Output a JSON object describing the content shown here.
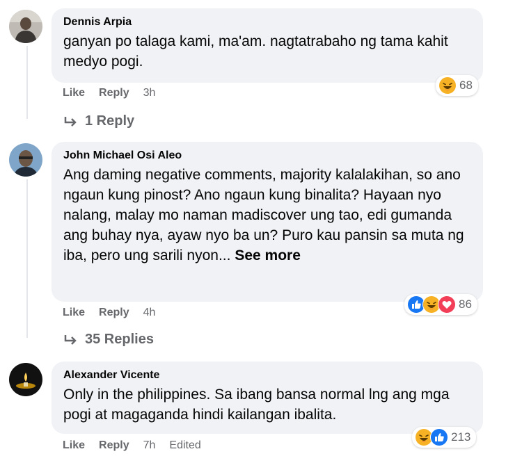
{
  "comments": [
    {
      "author": "Dennis Arpia",
      "text": "ganyan po talaga kami, ma'am. nagtatrabaho ng tama kahit medyo pogi.",
      "like": "Like",
      "reply": "Reply",
      "time": "3h",
      "reaction_count": "68",
      "reactions": [
        "haha-icon"
      ],
      "replies_label": "1 Reply"
    },
    {
      "author": "John Michael Osi Aleo",
      "text": "Ang daming negative comments, majority kalalakihan, so ano ngaun kung pinost? Ano ngaun kung binalita? Hayaan nyo nalang, malay mo naman madiscover ung tao, edi gumanda ang buhay nya, ayaw nyo ba un? Puro kau pansin sa muta ng iba, pero ung sarili nyon...",
      "see_more": "See more",
      "like": "Like",
      "reply": "Reply",
      "time": "4h",
      "reaction_count": "86",
      "reactions": [
        "like-icon",
        "haha-icon",
        "love-icon"
      ],
      "replies_label": "35 Replies"
    },
    {
      "author": "Alexander Vicente",
      "text": "Only in the philippines. Sa ibang bansa normal lng ang mga pogi at magaganda hindi kailangan ibalita.",
      "like": "Like",
      "reply": "Reply",
      "time": "7h",
      "edited": "Edited",
      "reaction_count": "213",
      "reactions": [
        "haha-icon",
        "like-icon"
      ]
    }
  ],
  "colors": {
    "bubble": "#f0f2f5",
    "secondary_text": "#65676b",
    "like_blue": "#1877f2",
    "love_red": "#f33e58",
    "haha_yellow": "#f7b125"
  }
}
